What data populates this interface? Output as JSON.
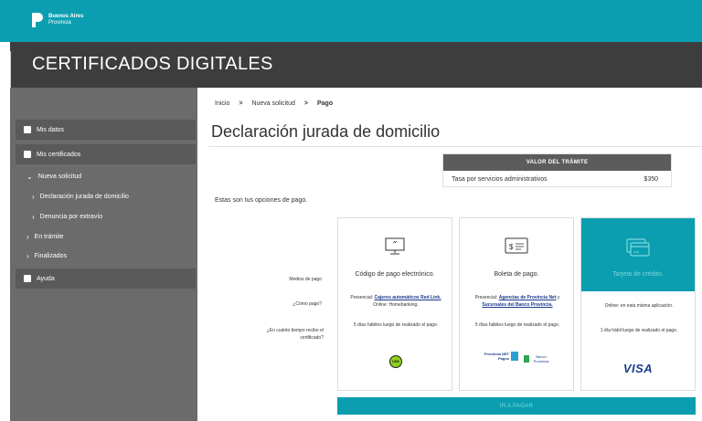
{
  "brand": {
    "line1": "Buenos Aires",
    "line2": "Provincia"
  },
  "header": {
    "title": "CERTIFICADOS DIGITALES"
  },
  "sidebar": {
    "mis_datos": "Mis datos",
    "mis_certificados": "Mis certificados",
    "nueva_solicitud": "Nueva solicitud",
    "declaracion": "Declaración jurada de domicilio",
    "denuncia": "Denuncia por extravío",
    "en_tramite": "En trámite",
    "finalizados": "Finalizados",
    "ayuda": "Ayuda"
  },
  "breadcrumb": {
    "items": [
      "Inicio",
      "Nueva solicitud",
      "Pago"
    ],
    "separator": ">"
  },
  "page": {
    "title": "Declaración jurada de domicilio",
    "options_label": "Estas son tus opciones de pago."
  },
  "valor": {
    "header": "VALOR DEL TRÁMITE",
    "item": "Tasa por servicios administrativos",
    "price": "$350"
  },
  "row_labels": {
    "medios": "Medios de pago",
    "como": "¿Cómo pago?",
    "cuanto": "¿En cuánto tiempo recibo el certificado?"
  },
  "cards": [
    {
      "title": "Código de pago electrónico.",
      "how_prefix": "Presencial: ",
      "how_link": "Cajeros automáticos Red Link.",
      "how_suffix": " Online: Homebanking.",
      "time": "5 días hábiles luego de realizado el pago.",
      "brand": "LINK"
    },
    {
      "title": "Boleta de pago.",
      "how_prefix": "Presencial: ",
      "how_link": "Agencias de Provincia Net",
      "how_mid": " y ",
      "how_link2": "Sucursales del Banco Provincia.",
      "time": "5 días hábiles luego de realizado el pago.",
      "brand1": "Provincia NET Pagos",
      "brand2": "Banco Provincia"
    },
    {
      "title": "Tarjeta de crédito.",
      "how": "Online: en esta misma aplicación.",
      "time": "1 día hábil luego de realizado el pago.",
      "brand": "VISA"
    }
  ],
  "pay_button": "IR A PAGAR",
  "colors": {
    "teal": "#0a9eb0",
    "dark": "#3d3d3d",
    "sidebar": "#6b6b6b"
  }
}
